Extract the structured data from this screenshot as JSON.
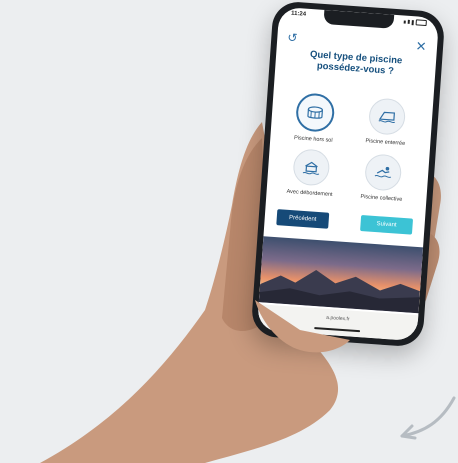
{
  "status_bar": {
    "time": "11:24"
  },
  "modal": {
    "title_line1": "Quel type de piscine",
    "title_line2": "possédez-vous ?",
    "options": [
      {
        "label": "Piscine hors sol"
      },
      {
        "label": "Piscine enterrée"
      },
      {
        "label": "Avec débordement"
      },
      {
        "label": "Piscine collective"
      }
    ],
    "prev_label": "Précédent",
    "next_label": "Suivant"
  },
  "browser": {
    "url": "a.poolex.fr"
  },
  "icons": {
    "reload": "reload-icon",
    "close": "close-icon",
    "above_ground_pool": "above-ground-pool-icon",
    "inground_pool": "inground-pool-icon",
    "infinity_pool": "infinity-pool-icon",
    "collective_pool": "swimmer-icon"
  },
  "colors": {
    "primary": "#16507e",
    "accent": "#3cc3d5",
    "icon_blue": "#2f6fa5"
  }
}
